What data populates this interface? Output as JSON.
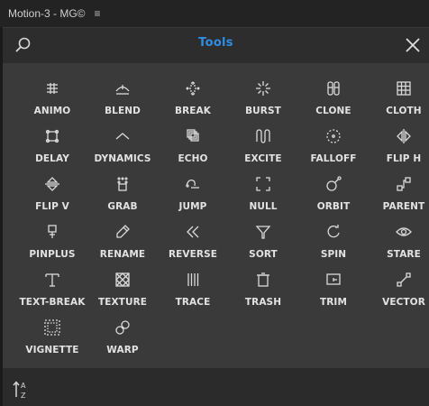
{
  "window": {
    "title": "Motion-3 - MG©",
    "menu_glyph": "≡"
  },
  "header": {
    "title": "Tools",
    "search_icon": "search-icon",
    "close_icon": "close-icon",
    "accent": "#2f8de4"
  },
  "tools": [
    {
      "label": "ANIMO",
      "icon": "animo"
    },
    {
      "label": "BLEND",
      "icon": "blend"
    },
    {
      "label": "BREAK",
      "icon": "break"
    },
    {
      "label": "BURST",
      "icon": "burst"
    },
    {
      "label": "CLONE",
      "icon": "clone"
    },
    {
      "label": "CLOTH",
      "icon": "cloth"
    },
    {
      "label": "DELAY",
      "icon": "delay"
    },
    {
      "label": "DYNAMICS",
      "icon": "dynamics"
    },
    {
      "label": "ECHO",
      "icon": "echo"
    },
    {
      "label": "EXCITE",
      "icon": "excite"
    },
    {
      "label": "FALLOFF",
      "icon": "falloff"
    },
    {
      "label": "FLIP H",
      "icon": "fliph"
    },
    {
      "label": "FLIP V",
      "icon": "flipv"
    },
    {
      "label": "GRAB",
      "icon": "grab"
    },
    {
      "label": "JUMP",
      "icon": "jump"
    },
    {
      "label": "NULL",
      "icon": "null"
    },
    {
      "label": "ORBIT",
      "icon": "orbit"
    },
    {
      "label": "PARENT",
      "icon": "parent"
    },
    {
      "label": "PINPLUS",
      "icon": "pinplus"
    },
    {
      "label": "RENAME",
      "icon": "rename"
    },
    {
      "label": "REVERSE",
      "icon": "reverse"
    },
    {
      "label": "SORT",
      "icon": "sort"
    },
    {
      "label": "SPIN",
      "icon": "spin"
    },
    {
      "label": "STARE",
      "icon": "stare"
    },
    {
      "label": "TEXT-BREAK",
      "icon": "textbreak"
    },
    {
      "label": "TEXTURE",
      "icon": "texture"
    },
    {
      "label": "TRACE",
      "icon": "trace"
    },
    {
      "label": "TRASH",
      "icon": "trash"
    },
    {
      "label": "TRIM",
      "icon": "trim"
    },
    {
      "label": "VECTOR",
      "icon": "vector"
    },
    {
      "label": "VIGNETTE",
      "icon": "vignette"
    },
    {
      "label": "WARP",
      "icon": "warp"
    }
  ],
  "footer": {
    "sort_icon": "sort-az-icon"
  }
}
